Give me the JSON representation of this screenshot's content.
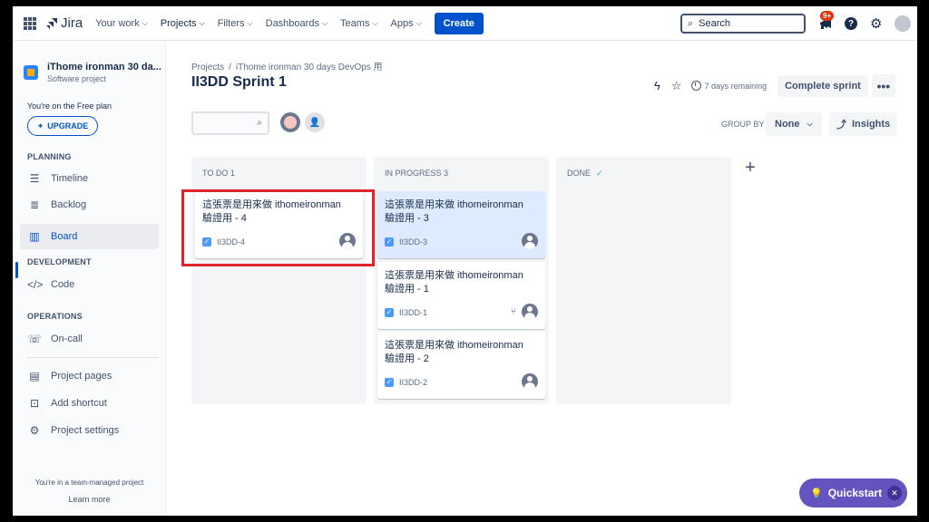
{
  "topnav": {
    "logo": "Jira",
    "items": [
      {
        "label": "Your work"
      },
      {
        "label": "Projects"
      },
      {
        "label": "Filters"
      },
      {
        "label": "Dashboards"
      },
      {
        "label": "Teams"
      },
      {
        "label": "Apps"
      }
    ],
    "create": "Create",
    "search_placeholder": "Search",
    "notif_badge": "9+"
  },
  "sidebar": {
    "project_name": "iThome ironman 30 da...",
    "project_type": "Software project",
    "plan": "You're on the Free plan",
    "upgrade": "UPGRADE",
    "sections": {
      "planning": "PLANNING",
      "development": "DEVELOPMENT",
      "operations": "OPERATIONS"
    },
    "items": [
      {
        "label": "Timeline"
      },
      {
        "label": "Backlog"
      },
      {
        "label": "Board"
      },
      {
        "label": "Code"
      },
      {
        "label": "On-call"
      },
      {
        "label": "Project pages"
      },
      {
        "label": "Add shortcut"
      },
      {
        "label": "Project settings"
      }
    ],
    "footer_text": "You're in a team-managed project",
    "learn_more": "Learn more"
  },
  "main": {
    "breadcrumb": {
      "projects": "Projects",
      "separator": "/",
      "project": "iThome ironman 30 days DevOps 用"
    },
    "title": "II3DD Sprint 1",
    "days_remaining": "7 days remaining",
    "complete_sprint": "Complete sprint",
    "more": "•••",
    "group_by_label": "GROUP BY",
    "group_by_value": "None",
    "insights": "Insights"
  },
  "columns": [
    {
      "title": "TO DO 1"
    },
    {
      "title": "IN PROGRESS 3"
    },
    {
      "title": "DONE"
    }
  ],
  "cards": [
    {
      "title": "這張票是用來做 ithomeironman 驗證用 - 4",
      "key": "II3DD-4"
    },
    {
      "title": "這張票是用來做 ithomeironman 驗證用 - 3",
      "key": "II3DD-3"
    },
    {
      "title": "這張票是用來做 ithomeironman 驗證用 - 1",
      "key": "II3DD-1"
    },
    {
      "title": "這張票是用來做 ithomeironman 驗證用 - 2",
      "key": "II3DD-2"
    }
  ],
  "quickstart": "Quickstart",
  "colors": {
    "accent": "#0052cc",
    "highlight": "#e0242e",
    "quickstart": "#6554c0"
  }
}
